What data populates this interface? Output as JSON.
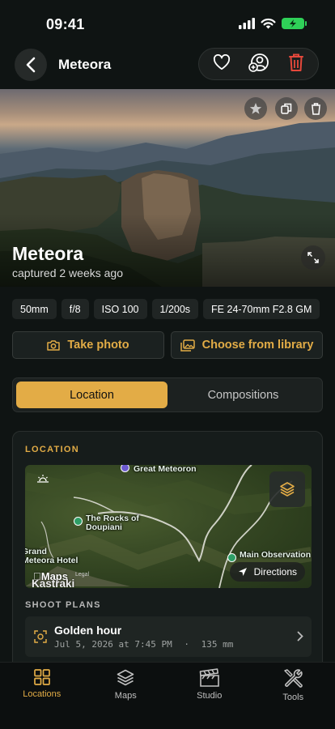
{
  "status": {
    "time": "09:41"
  },
  "nav": {
    "title": "Meteora"
  },
  "hero": {
    "title": "Meteora",
    "subtitle": "captured 2 weeks ago"
  },
  "specs": [
    "50mm",
    "f/8",
    "ISO 100",
    "1/200s",
    "FE 24-70mm F2.8 GM"
  ],
  "actions": {
    "take_photo": "Take photo",
    "choose_library": "Choose from library"
  },
  "segment": {
    "location": "Location",
    "compositions": "Compositions"
  },
  "card": {
    "label": "LOCATION",
    "map": {
      "labels": {
        "great": "Great Meteoron",
        "rocks": "The Rocks of Doupiani",
        "main_obs": "Main Observation Deck of Meteora",
        "grand": "Grand Meteora Hotel",
        "town": "Kastraki"
      },
      "maps_brand": "Maps",
      "legal": "Legal",
      "directions": "Directions"
    },
    "plans_label": "SHOOT PLANS",
    "plan": {
      "title": "Golden hour",
      "date": "Jul 5, 2026 at 7:45 PM",
      "sep": "·",
      "focal": "135 mm"
    }
  },
  "tabs": [
    {
      "label": "Locations"
    },
    {
      "label": "Maps"
    },
    {
      "label": "Studio"
    },
    {
      "label": "Tools"
    }
  ],
  "colors": {
    "accent": "#e3ac46",
    "delete": "#e5483b",
    "battery": "#2fd158"
  }
}
